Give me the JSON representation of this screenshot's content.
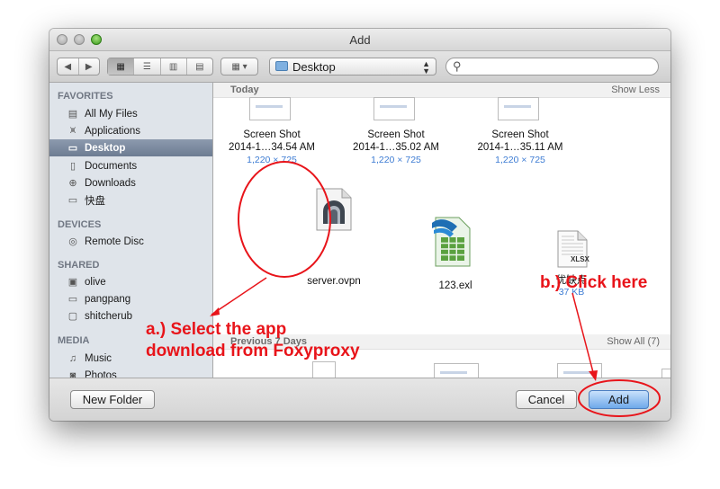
{
  "window": {
    "title": "Add"
  },
  "toolbar": {
    "location": "Desktop",
    "search_placeholder": ""
  },
  "sidebar": {
    "sections": [
      {
        "title": "FAVORITES",
        "items": [
          {
            "label": "All My Files",
            "icon": "all-files-icon"
          },
          {
            "label": "Applications",
            "icon": "applications-icon"
          },
          {
            "label": "Desktop",
            "icon": "desktop-icon",
            "selected": true
          },
          {
            "label": "Documents",
            "icon": "documents-icon"
          },
          {
            "label": "Downloads",
            "icon": "downloads-icon"
          },
          {
            "label": "快盘",
            "icon": "folder-icon"
          }
        ]
      },
      {
        "title": "DEVICES",
        "items": [
          {
            "label": "Remote Disc",
            "icon": "disc-icon"
          }
        ]
      },
      {
        "title": "SHARED",
        "items": [
          {
            "label": "olive",
            "icon": "computer-icon"
          },
          {
            "label": "pangpang",
            "icon": "computer-icon"
          },
          {
            "label": "shitcherub",
            "icon": "display-icon"
          }
        ]
      },
      {
        "title": "MEDIA",
        "items": [
          {
            "label": "Music",
            "icon": "music-icon"
          },
          {
            "label": "Photos",
            "icon": "camera-icon"
          }
        ]
      }
    ]
  },
  "content": {
    "today": {
      "title": "Today",
      "action": "Show Less",
      "files": [
        {
          "name_line1": "Screen Shot",
          "name_line2": "2014-1…34.54 AM",
          "size": "1,220 × 725"
        },
        {
          "name_line1": "Screen Shot",
          "name_line2": "2014-1…35.02 AM",
          "size": "1,220 × 725"
        },
        {
          "name_line1": "Screen Shot",
          "name_line2": "2014-1…35.11 AM",
          "size": "1,220 × 725"
        },
        {
          "name_line1": "server.ovpn",
          "name_line2": "",
          "size": ""
        },
        {
          "name_line1": "123.exl",
          "name_line2": "",
          "size": ""
        },
        {
          "name_line1": "优缺点",
          "name_line2": "",
          "size": "37 KB"
        }
      ],
      "xlsx_badge": "XLSX"
    },
    "previous": {
      "title": "Previous 7 Days",
      "action": "Show All (7)"
    }
  },
  "buttons": {
    "new_folder": "New Folder",
    "cancel": "Cancel",
    "add": "Add"
  },
  "annotations": {
    "a_line1": "a.) Select the app",
    "a_line2": "download from Foxyproxy",
    "b": "b.) Click here",
    "color": "#e8141a"
  }
}
